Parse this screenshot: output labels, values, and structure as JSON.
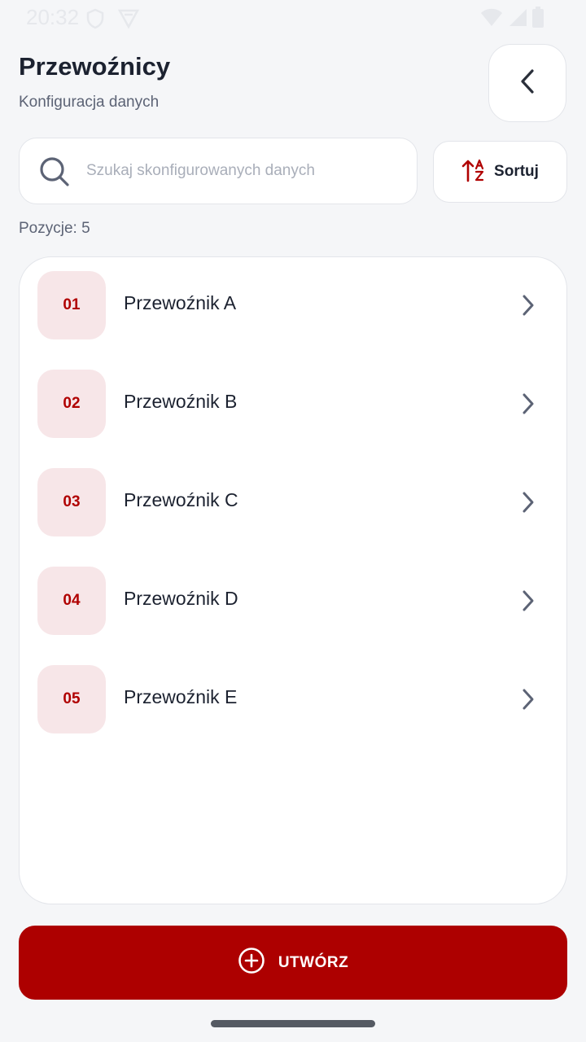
{
  "status_bar": {
    "time": "20:32",
    "icons": [
      "shield-icon",
      "app-icon",
      "wifi-icon",
      "signal-icon",
      "battery-icon"
    ]
  },
  "header": {
    "title": "Przewoźnicy",
    "subtitle": "Konfiguracja danych",
    "back_icon": "chevron-left-icon"
  },
  "search": {
    "placeholder": "Szukaj skonfigurowanych danych",
    "value": "",
    "icon": "search-icon"
  },
  "sort": {
    "label": "Sortuj",
    "icon": "sort-alpha-icon"
  },
  "count_label": "Pozycje: 5",
  "items": [
    {
      "number": "01",
      "name": "Przewoźnik A"
    },
    {
      "number": "02",
      "name": "Przewoźnik B"
    },
    {
      "number": "03",
      "name": "Przewoźnik C"
    },
    {
      "number": "04",
      "name": "Przewoźnik D"
    },
    {
      "number": "05",
      "name": "Przewoźnik E"
    }
  ],
  "create_button": {
    "label": "UTWÓRZ",
    "icon": "plus-circle-icon"
  },
  "colors": {
    "accent": "#ad0000",
    "badge_bg": "#f7e6e8",
    "background": "#f5f6f8"
  }
}
